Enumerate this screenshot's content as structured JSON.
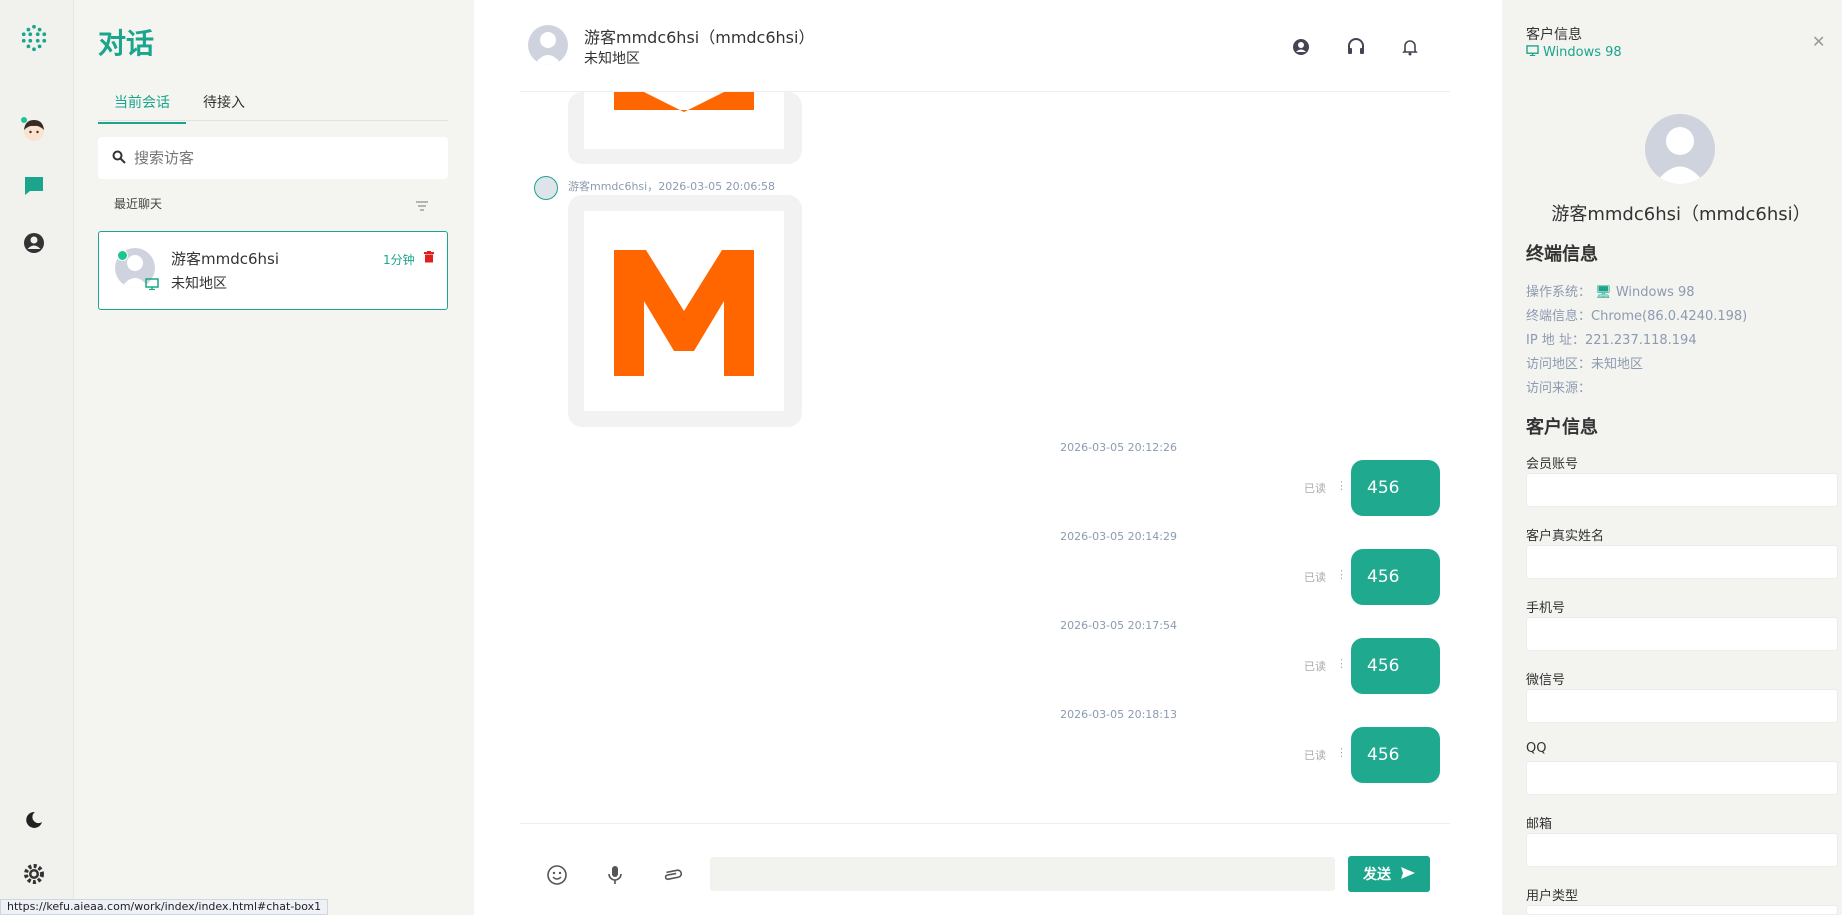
{
  "sidebar": {
    "icons": [
      "logo-dots-icon",
      "user-avatar-icon",
      "chat-icon",
      "profile-icon",
      "moon-icon",
      "settings-icon"
    ]
  },
  "list": {
    "title": "对话",
    "tabs": [
      {
        "label": "当前会话"
      },
      {
        "label": "待接入"
      }
    ],
    "search_placeholder": "搜索访客",
    "recent_label": "最近聊天",
    "conversations": [
      {
        "name": "游客mmdc6hsi",
        "region": "未知地区",
        "time": "1分钟"
      }
    ]
  },
  "chat": {
    "header": {
      "name": "游客mmdc6hsi（mmdc6hsi）",
      "region": "未知地区"
    },
    "incoming_meta": "游客mmdc6hsi，2026-03-05 20:06:58",
    "messages": [
      {
        "time": "2026-03-05 20:12:26",
        "status": "已读",
        "text": "456"
      },
      {
        "time": "2026-03-05 20:14:29",
        "status": "已读",
        "text": "456"
      },
      {
        "time": "2026-03-05 20:17:54",
        "status": "已读",
        "text": "456"
      },
      {
        "time": "2026-03-05 20:18:13",
        "status": "已读",
        "text": "456"
      }
    ],
    "send_label": "发送"
  },
  "right": {
    "title": "客户信息",
    "os": "Windows 98",
    "name": "游客mmdc6hsi（mmdc6hsi）",
    "terminal_heading": "终端信息",
    "terminal": {
      "os_label": "操作系统：",
      "os_value": "Windows 98",
      "client_label": "终端信息：",
      "client_value": "Chrome(86.0.4240.198)",
      "ip_label": "IP 地 址：",
      "ip_value": "221.237.118.194",
      "region_label": "访问地区：",
      "region_value": "未知地区",
      "source_label": "访问来源："
    },
    "customer_heading": "客户信息",
    "fields": [
      {
        "label": "会员账号"
      },
      {
        "label": "客户真实姓名"
      },
      {
        "label": "手机号"
      },
      {
        "label": "微信号"
      },
      {
        "label": "QQ"
      },
      {
        "label": "邮箱"
      },
      {
        "label": "用户类型"
      }
    ]
  },
  "status_url": "https://kefu.aieaa.com/work/index/index.html#chat-box1",
  "colors": {
    "accent": "#1aa58c",
    "bubble": "#1fa98f",
    "brand_orange": "#ff6600"
  }
}
